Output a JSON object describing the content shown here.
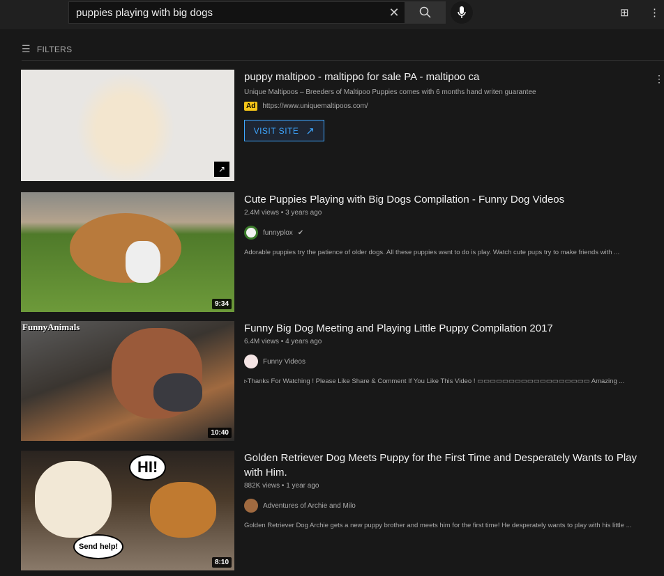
{
  "search": {
    "query": "puppies playing with big dogs"
  },
  "filters_label": "FILTERS",
  "ad": {
    "title": "puppy maltipoo - maltippo for sale PA - maltipoo ca",
    "description": "Unique Maltipoos – Breeders of Maltipoo Puppies comes with 6 months hand writen guarantee",
    "badge": "Ad",
    "url": "https://www.uniquemaltipoos.com/",
    "button": "VISIT SITE"
  },
  "videos": [
    {
      "title": "Cute Puppies Playing with Big Dogs Compilation - Funny Dog Videos",
      "meta": "2.4M views • 3 years ago",
      "channel": "funnyplox",
      "verified": true,
      "description": "Adorable puppies try the patience of older dogs. All these puppies want to do is play. Watch cute pups try to make friends with ...",
      "duration": "9:34"
    },
    {
      "title": "Funny Big Dog Meeting and Playing Little Puppy Compilation 2017",
      "meta": "6.4M views • 4 years ago",
      "channel": "Funny Videos",
      "description": "▹Thanks For Watching ! Please Like Share & Comment If You Like This Video ! ▭▭▭▭▭▭▭▭▭▭▭▭▭▭▭▭▭▭ Amazing ...",
      "duration": "10:40",
      "thumb_text": "FunnyAnimals"
    },
    {
      "title": "Golden Retriever Dog Meets Puppy for the First Time and Desperately Wants to Play with Him.",
      "meta": "882K views • 1 year ago",
      "channel": "Adventures of Archie and Milo",
      "description": "Golden Retriever Dog Archie gets a new puppy brother and meets him for the first time! He desperately wants to play with his little ...",
      "duration": "8:10",
      "thumb_bubbles": [
        "HI!",
        "Send help!"
      ]
    }
  ]
}
